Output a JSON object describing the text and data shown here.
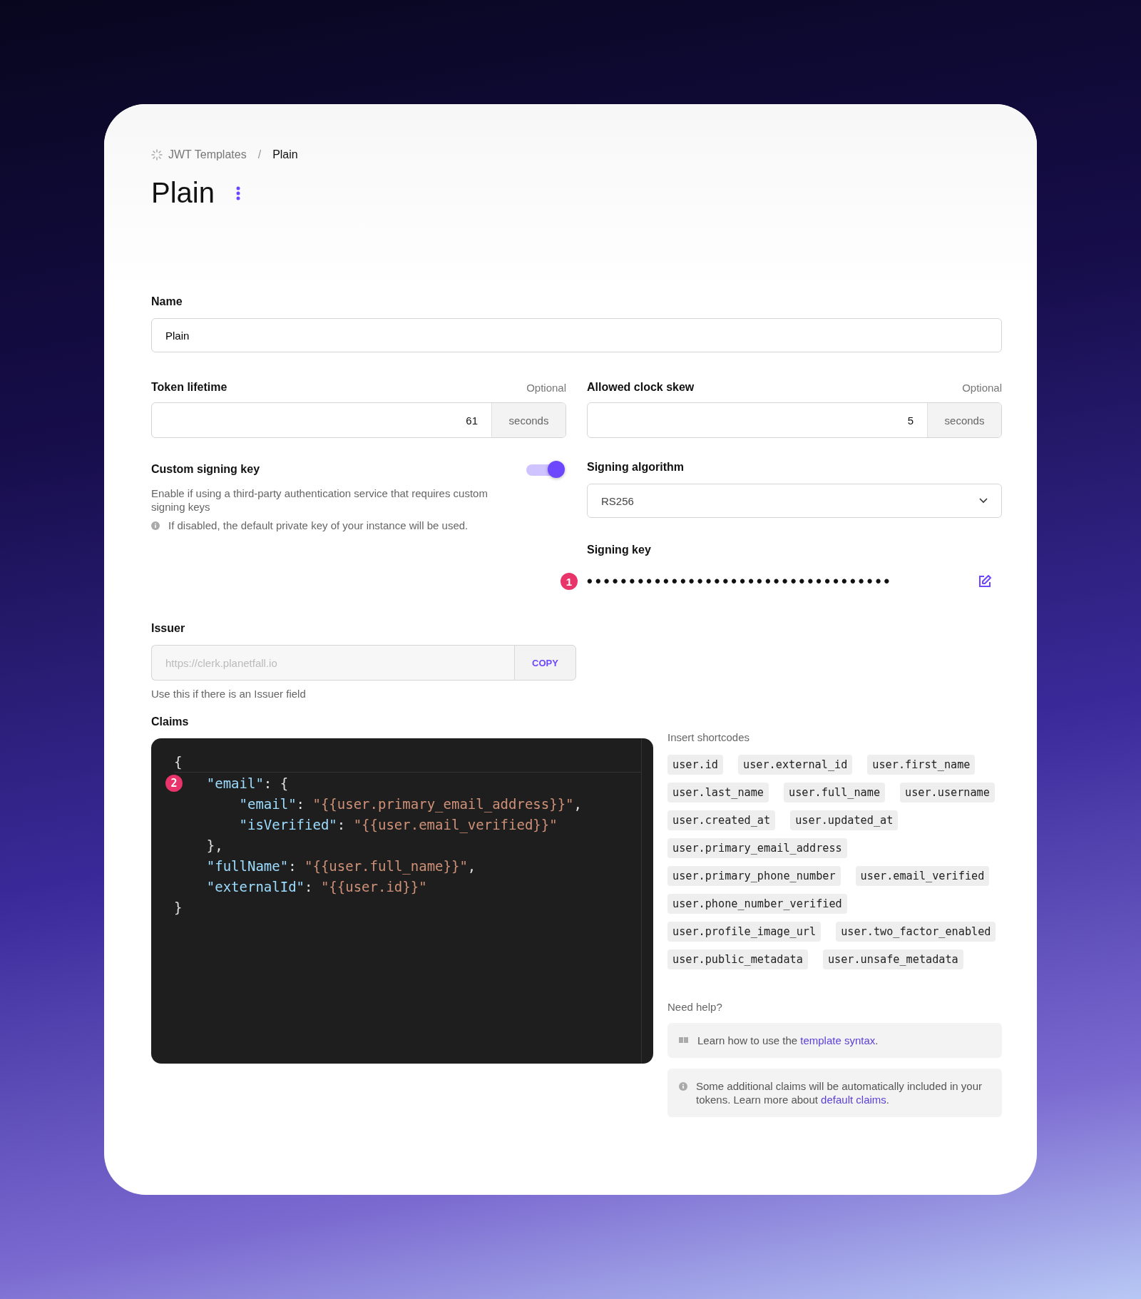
{
  "breadcrumb": {
    "items": [
      {
        "label": "JWT Templates",
        "current": false
      },
      {
        "label": "Plain",
        "current": true
      }
    ],
    "separator": "/"
  },
  "title": "Plain",
  "name": {
    "label": "Name",
    "value": "Plain"
  },
  "token_lifetime": {
    "label": "Token lifetime",
    "hint": "Optional",
    "value": "61",
    "unit": "seconds"
  },
  "clock_skew": {
    "label": "Allowed clock skew",
    "hint": "Optional",
    "value": "5",
    "unit": "seconds"
  },
  "custom_signing_key": {
    "label": "Custom signing key",
    "description": "Enable if using a third-party authentication service that requires custom signing keys",
    "note": "If disabled, the default private key of your instance will be used.",
    "on": true
  },
  "signing_algorithm": {
    "label": "Signing algorithm",
    "value": "RS256"
  },
  "signing_key": {
    "label": "Signing key",
    "marker": "1",
    "value": "••••••••••••••••••••••••••••••••••••"
  },
  "issuer": {
    "label": "Issuer",
    "placeholder": "https://clerk.planetfall.io",
    "button": "COPY",
    "help": "Use this if there is an Issuer field"
  },
  "claims": {
    "label": "Claims",
    "marker": "2",
    "lines": [
      [
        {
          "kind": "punct",
          "text": "{"
        }
      ],
      [
        {
          "kind": "key",
          "text": "    \"email\""
        },
        {
          "kind": "punct",
          "text": ": {"
        }
      ],
      [
        {
          "kind": "key",
          "text": "        \"email\""
        },
        {
          "kind": "punct",
          "text": ": "
        },
        {
          "kind": "string",
          "text": "\"{{user.primary_email_address}}\""
        },
        {
          "kind": "punct",
          "text": ","
        }
      ],
      [
        {
          "kind": "key",
          "text": "        \"isVerified\""
        },
        {
          "kind": "punct",
          "text": ": "
        },
        {
          "kind": "string",
          "text": "\"{{user.email_verified}}\""
        }
      ],
      [
        {
          "kind": "punct",
          "text": "    },"
        }
      ],
      [
        {
          "kind": "key",
          "text": "    \"fullName\""
        },
        {
          "kind": "punct",
          "text": ": "
        },
        {
          "kind": "string",
          "text": "\"{{user.full_name}}\""
        },
        {
          "kind": "punct",
          "text": ","
        }
      ],
      [
        {
          "kind": "key",
          "text": "    \"externalId\""
        },
        {
          "kind": "punct",
          "text": ": "
        },
        {
          "kind": "string",
          "text": "\"{{user.id}}\""
        }
      ],
      [
        {
          "kind": "punct",
          "text": "}"
        }
      ]
    ]
  },
  "shortcodes": {
    "label": "Insert shortcodes",
    "items": [
      "user.id",
      "user.external_id",
      "user.first_name",
      "user.last_name",
      "user.full_name",
      "user.username",
      "user.created_at",
      "user.updated_at",
      "user.primary_email_address",
      "user.primary_phone_number",
      "user.email_verified",
      "user.phone_number_verified",
      "user.profile_image_url",
      "user.two_factor_enabled",
      "user.public_metadata",
      "user.unsafe_metadata"
    ]
  },
  "help": {
    "label": "Need help?",
    "notes": [
      {
        "kind": "book",
        "text": "Learn how to use the ",
        "link": "template syntax",
        "after": "."
      },
      {
        "kind": "info",
        "text": "Some additional claims will be automatically included in your tokens. Learn more about ",
        "link": "default claims",
        "after": "."
      }
    ]
  }
}
